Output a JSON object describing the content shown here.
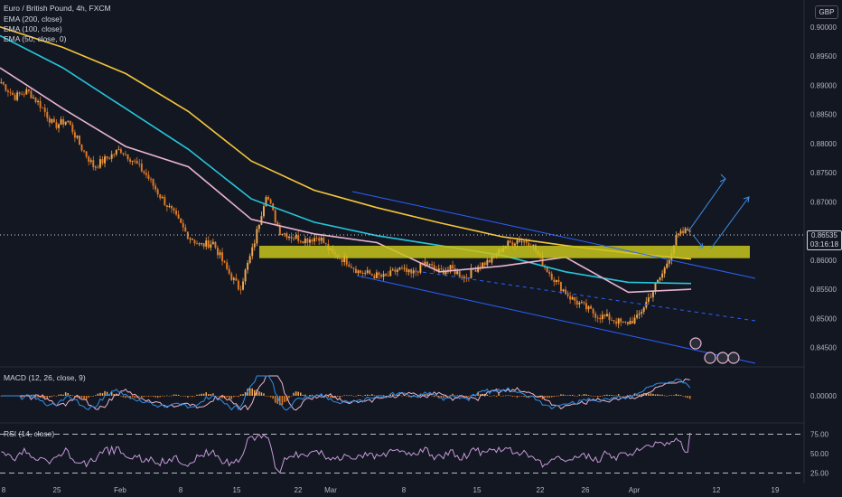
{
  "header": {
    "title": "Euro / British Pound, 4h, FXCM",
    "currency": "GBP",
    "indicators": [
      "EMA (200, close)",
      "EMA (100, close)",
      "EMA (50, close, 0)"
    ]
  },
  "colors": {
    "background": "#131722",
    "candle_up": "#f0a850",
    "candle_down": "#e07a26",
    "ema200": "#f5c53a",
    "ema100": "#26c6da",
    "ema50": "#e8b4d0",
    "channel": "#2962ff",
    "zone": "#c8c41c",
    "macd": "#2f8fe8",
    "signal": "#e8b4d0",
    "rsi": "#c59ad8",
    "grid_text": "#b2b5be"
  },
  "price_axis": {
    "ticks": [
      "0.90000",
      "0.89500",
      "0.89000",
      "0.88500",
      "0.88000",
      "0.87500",
      "0.87000",
      "0.86000",
      "0.85500",
      "0.85000",
      "0.84500"
    ],
    "current_price": "0.86535",
    "countdown": "03:16:18"
  },
  "time_axis": {
    "labels": [
      "8",
      "25",
      "Feb",
      "8",
      "15",
      "22",
      "Mar",
      "8",
      "15",
      "22",
      "26",
      "Apr",
      "12",
      "19"
    ]
  },
  "macd_pane": {
    "label": "MACD (12, 26, close, 9)",
    "tick": "0.00000"
  },
  "rsi_pane": {
    "label": "RSI (14, close)",
    "ticks": [
      "75.00",
      "50.00",
      "25.00"
    ]
  },
  "chart_data": {
    "type": "candlestick",
    "symbol": "EURGBP",
    "timeframe": "4h",
    "ylim": [
      0.842,
      0.904
    ],
    "price_path": [
      0.8905,
      0.888,
      0.889,
      0.8865,
      0.883,
      0.884,
      0.8795,
      0.876,
      0.8775,
      0.879,
      0.877,
      0.8745,
      0.871,
      0.868,
      0.8645,
      0.8625,
      0.863,
      0.8585,
      0.855,
      0.862,
      0.8715,
      0.865,
      0.864,
      0.8635,
      0.864,
      0.861,
      0.86,
      0.858,
      0.8575,
      0.857,
      0.8585,
      0.8575,
      0.8595,
      0.858,
      0.8585,
      0.857,
      0.859,
      0.86,
      0.8625,
      0.8635,
      0.863,
      0.859,
      0.856,
      0.8535,
      0.852,
      0.8505,
      0.85,
      0.849,
      0.85,
      0.854,
      0.858,
      0.864,
      0.8654
    ],
    "ema200": [
      0.9,
      0.8965,
      0.892,
      0.8855,
      0.877,
      0.872,
      0.869,
      0.8664,
      0.864,
      0.8625,
      0.8612,
      0.8602
    ],
    "ema100": [
      0.8985,
      0.893,
      0.886,
      0.879,
      0.8705,
      0.8665,
      0.8642,
      0.8625,
      0.8608,
      0.858,
      0.8562,
      0.856
    ],
    "ema50": [
      0.893,
      0.886,
      0.8795,
      0.876,
      0.867,
      0.8645,
      0.863,
      0.858,
      0.859,
      0.8605,
      0.8545,
      0.855
    ],
    "zone": [
      0.8608,
      0.862
    ],
    "rsi_levels": [
      75,
      50,
      25
    ],
    "rsi_last": 77,
    "annotations": [
      "descending channel",
      "resistance zone",
      "breakout arrows"
    ]
  }
}
